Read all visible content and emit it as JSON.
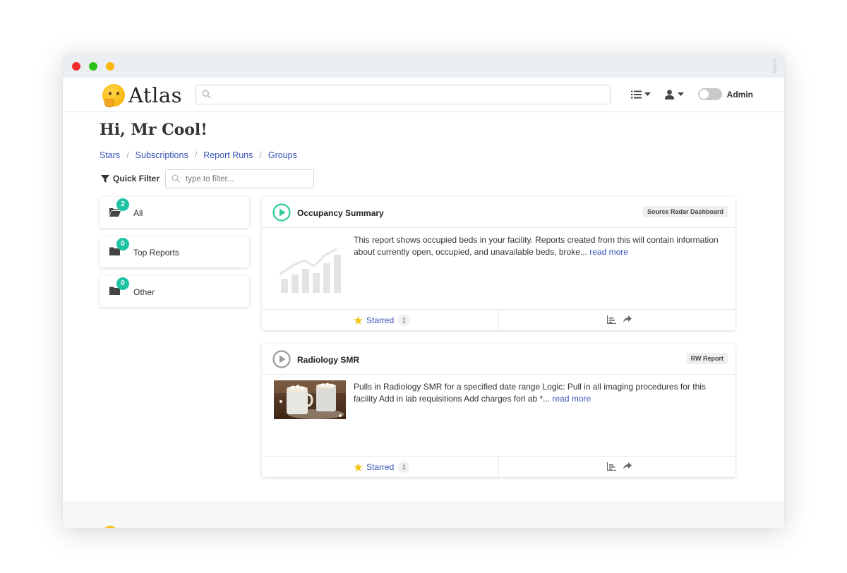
{
  "app": {
    "logo_text": "Atlas",
    "greeting": "Hi, Mr Cool!",
    "admin_label": "Admin"
  },
  "search": {
    "placeholder": "",
    "value": ""
  },
  "breadcrumb": [
    {
      "label": "Stars"
    },
    {
      "label": "Subscriptions"
    },
    {
      "label": "Report Runs"
    },
    {
      "label": "Groups"
    }
  ],
  "quick_filter": {
    "label": "Quick Filter",
    "placeholder": "type to filter..."
  },
  "groups": [
    {
      "label": "All",
      "count": "2",
      "icon": "folder-open-icon"
    },
    {
      "label": "Top Reports",
      "count": "0",
      "icon": "folder-icon"
    },
    {
      "label": "Other",
      "count": "0",
      "icon": "folder-icon"
    }
  ],
  "reports": [
    {
      "title": "Occupancy Summary",
      "tag": "Source Radar Dashboard",
      "description": "This report shows occupied beds in your facility. Reports created from this will contain information about currently open, occupied, and unavailable beds, broke...",
      "read_more": "read more",
      "starred_label": "Starred",
      "star_count": "1",
      "status_color": "#2ecc8f",
      "thumbnail": "chart-placeholder-icon"
    },
    {
      "title": "Radiology SMR",
      "tag": "RW Report",
      "description": "Pulls in Radiology SMR for a specified date range Logic: Pull in all imaging procedures for this facility Add in lab requisitions Add charges forl ab *...",
      "read_more": "read more",
      "starred_label": "Starred",
      "star_count": "1",
      "status_color": "#9a9a9a",
      "thumbnail": "cocoa-mugs-photo"
    }
  ],
  "colors": {
    "link": "#3954b5",
    "badge": "#1fc3a6",
    "star": "#f5c518"
  }
}
